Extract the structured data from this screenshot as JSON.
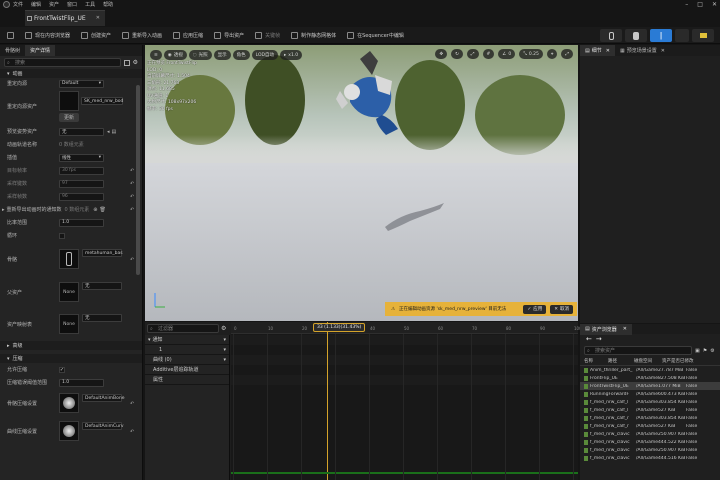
{
  "menu": [
    "文件",
    "编辑",
    "资产",
    "窗口",
    "工具",
    "帮助"
  ],
  "doc_tab": "FrontTwistFlip_UE",
  "toolbar": {
    "buttons": [
      "保存",
      "现在内容浏览器",
      "创建资产",
      "重新导入动画",
      "应用压缩",
      "导出资产",
      "关键帧",
      "制作静态网格体",
      "在Sequencer中编辑"
    ],
    "right_buttons": [
      "骨骼",
      "网格体",
      "动画",
      "Blueprint"
    ]
  },
  "left_panel": {
    "tabs": [
      "骨骼树",
      "资产详情"
    ],
    "search_placeholder": "搜索",
    "sections": {
      "animation": "动画",
      "compression": "压缩"
    },
    "props": [
      {
        "label": "重定向源",
        "value": "Default"
      },
      {
        "label": "重定向源资产",
        "value": "SK_med_nrw_bod"
      },
      {
        "label": "预览姿势资产",
        "value": "无"
      },
      {
        "label": "动画轨道名称",
        "value": "0 数组元素"
      },
      {
        "label": "插值",
        "value": "线性"
      },
      {
        "label": "目标帧率",
        "value": "30 fps"
      },
      {
        "label": "采样键数",
        "value": "97"
      },
      {
        "label": "采样帧数",
        "value": "96"
      },
      {
        "label": "重新导出动画时的通知数",
        "value": "0 数组元素"
      },
      {
        "label": "比率范围",
        "value": "1.0"
      },
      {
        "label": "循环",
        "value": ""
      },
      {
        "label": "骨骼",
        "value": "metahuman_bas"
      },
      {
        "label": "父资产",
        "value": "None"
      },
      {
        "label": "资产映射表",
        "value": "None"
      }
    ],
    "update_button": "更新",
    "collapsed_section": "高级",
    "compression": [
      {
        "label": "允许压缩",
        "value": ""
      },
      {
        "label": "压缩错误阈值范围",
        "value": "1.0"
      },
      {
        "label": "骨骼压缩设置",
        "value": "DefaultAnimBone"
      },
      {
        "label": "曲线压缩设置",
        "value": "DefaultAnimCurv"
      }
    ]
  },
  "viewport": {
    "toolbar": [
      "透视",
      "光照",
      "显示",
      "角色",
      "LOD自动",
      "x1.0"
    ],
    "right_controls": [
      "0",
      "0.25"
    ],
    "stats": [
      "正在预览 FrontTwistFlip",
      "LOD: 0",
      "当前屏幕尺寸: 1.504",
      "三角形: 21,763",
      "顶点: 11,685",
      "UV通道: 1",
      "大约尺寸: 108x97x206",
      "帧率: 30 fps"
    ],
    "notice_text": "正在编辑动画资源 'sk_med_nrw_preview' 目前无法",
    "notice_apply": "应用",
    "notice_cancel": "取消"
  },
  "sequencer": {
    "search_placeholder": "过滤器",
    "tracks": [
      "通知",
      "1",
      "曲线 (0)",
      "Additive层追踪轨道",
      "属性"
    ],
    "ruler_ticks": [
      "0",
      "10",
      "20",
      "30",
      "40",
      "50",
      "60",
      "70",
      "80",
      "90",
      "100"
    ],
    "playhead": "33 (1.133)(31.43%)"
  },
  "right_top": {
    "tabs": [
      "细节",
      "预览场景设置"
    ]
  },
  "content_browser": {
    "title": "资产浏览器",
    "search_placeholder": "搜索资产",
    "columns": [
      "名称",
      "路径",
      "磁盘空间",
      "资产是否已修改"
    ],
    "rows": [
      [
        "Anim_thriller_part_",
        "/All/Game",
        "27.787 MiB",
        "False"
      ],
      [
        "FrontFlip_UE",
        "/All/Game",
        "827.508 KiB",
        "False"
      ],
      [
        "FrontTwistFlip_UE",
        "/All/Game",
        "1.077 MiB",
        "False"
      ],
      [
        "RunningForwardF",
        "/All/Game",
        "600.473 KiB",
        "False"
      ],
      [
        "f_med_nrw_calf_l",
        "/All/Game",
        "303.854 KiB",
        "False"
      ],
      [
        "f_med_nrw_calf_l",
        "/All/Game",
        "527 KiB",
        "False"
      ],
      [
        "f_med_nrw_calf_r",
        "/All/Game",
        "303.854 KiB",
        "False"
      ],
      [
        "f_med_nrw_calf_r",
        "/All/Game",
        "527 KiB",
        "False"
      ],
      [
        "f_med_nrw_clavic",
        "/All/Game",
        "250.907 KiB",
        "False"
      ],
      [
        "f_med_nrw_clavic",
        "/All/Game",
        "444.522 KiB",
        "False"
      ],
      [
        "f_med_nrw_clavic",
        "/All/Game",
        "250.907 KiB",
        "False"
      ],
      [
        "f_med_nrw_clavic",
        "/All/Game",
        "444.516 KiB",
        "False"
      ]
    ],
    "selected_index": 2
  },
  "colors": {
    "accent_blue": "#2a7bd5",
    "notice_yellow": "#e6b23a",
    "playhead": "#d4a32a"
  }
}
